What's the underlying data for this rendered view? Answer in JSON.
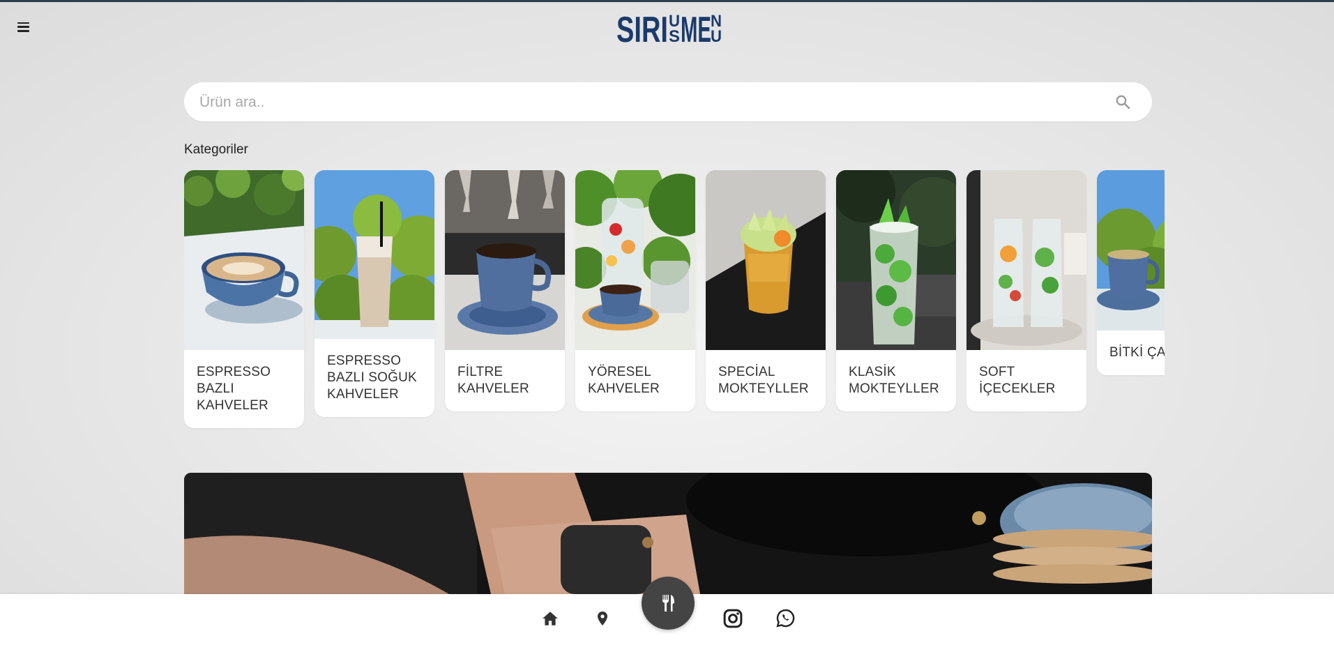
{
  "header": {
    "menu_icon": "hamburger-icon",
    "logo_text": "SIRIUS MENU"
  },
  "search": {
    "placeholder": "Ürün ara..",
    "value": "",
    "icon": "search-icon"
  },
  "categories": {
    "title": "Kategoriler",
    "items": [
      {
        "label": "ESPRESSO BAZLI KAHVELER"
      },
      {
        "label": "ESPRESSO BAZLI SOĞUK KAHVELER"
      },
      {
        "label": "FİLTRE KAHVELER"
      },
      {
        "label": "YÖRESEL KAHVELER"
      },
      {
        "label": "SPECİAL MOKTEYLLER"
      },
      {
        "label": "KLASİK MOKTEYLLER"
      },
      {
        "label": "SOFT İÇECEKLER"
      },
      {
        "label": "BİTKİ ÇAYLARI"
      }
    ]
  },
  "bottom_nav": {
    "items": [
      {
        "icon": "home-icon"
      },
      {
        "icon": "location-pin-icon"
      },
      {
        "icon": "fork-knife-icon"
      },
      {
        "icon": "instagram-icon"
      },
      {
        "icon": "whatsapp-icon"
      }
    ]
  },
  "colors": {
    "brand_blue": "#1b3a6b",
    "fab_gray": "#444444",
    "background": "#e6e6e6"
  }
}
